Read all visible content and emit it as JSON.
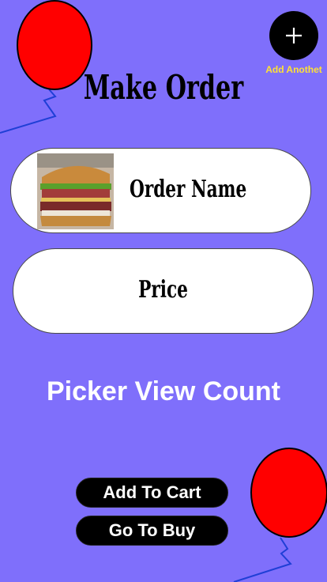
{
  "header": {
    "add_label": "Add Anothet",
    "title": "Make Order"
  },
  "order": {
    "name_label": "Order Name",
    "price_label": "Price",
    "image_icon": "sandwich-photo"
  },
  "picker": {
    "label": "Picker View Count"
  },
  "actions": {
    "add_to_cart": "Add To Cart",
    "go_to_buy": "Go To Buy"
  },
  "colors": {
    "background": "#7f6ffb",
    "balloon": "#ff0000",
    "add_label": "#ffe135"
  }
}
